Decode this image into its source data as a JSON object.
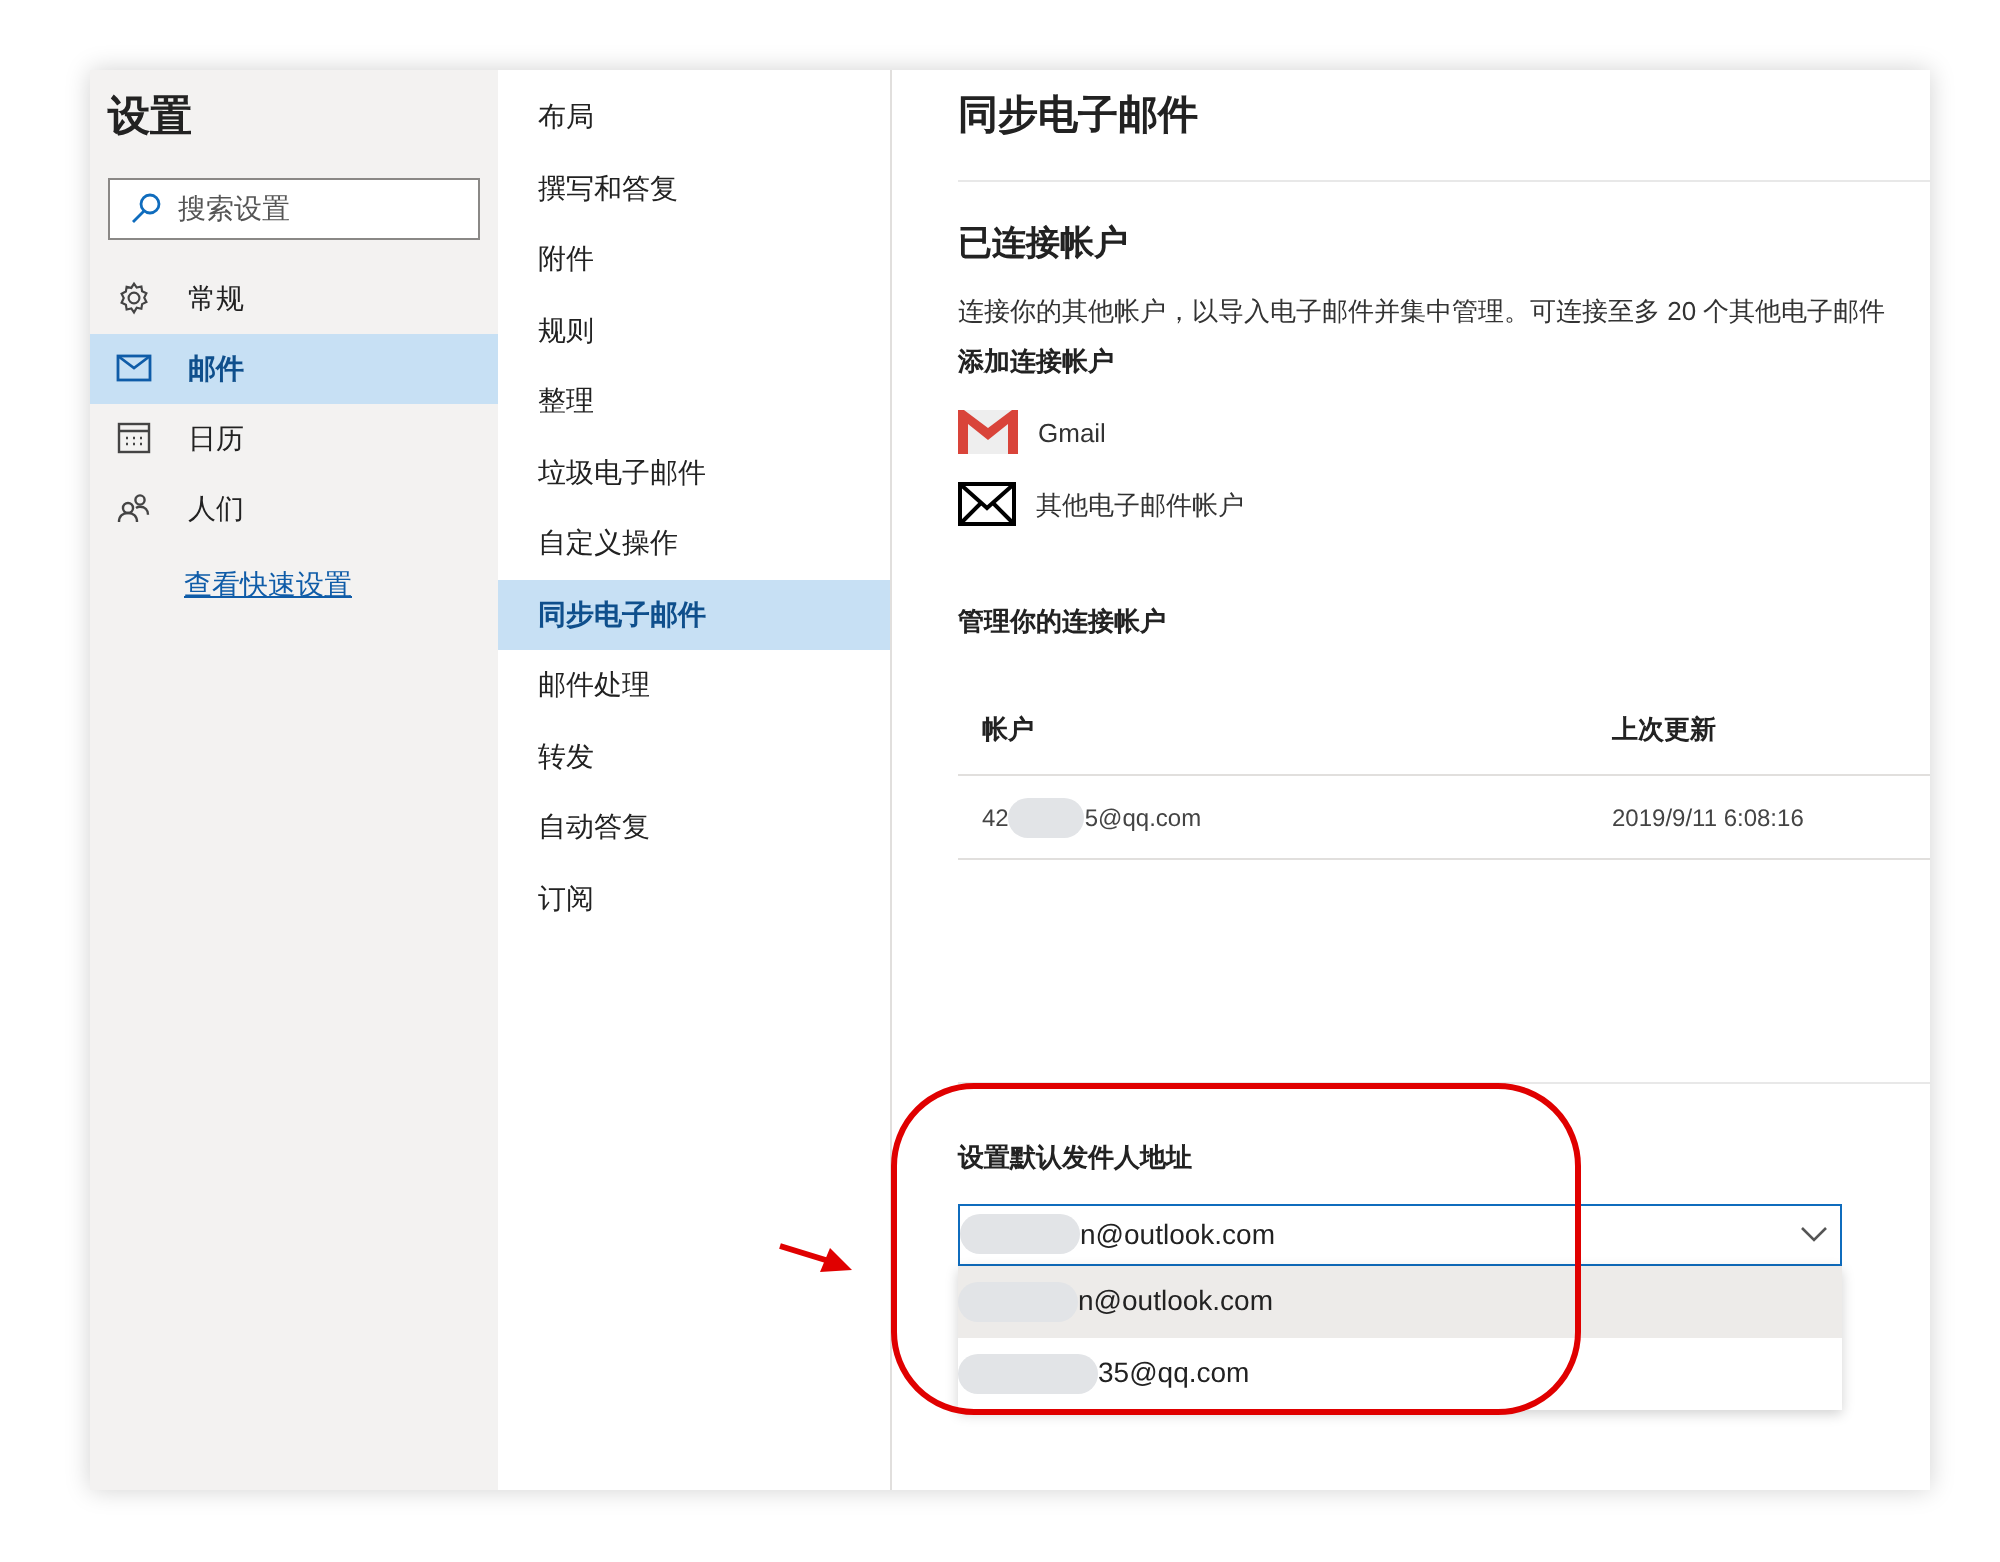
{
  "sidebar": {
    "title": "设置",
    "search": {
      "placeholder": "搜索设置"
    },
    "items": [
      {
        "kind": "gear",
        "label": "常规",
        "selected": false
      },
      {
        "kind": "mail",
        "label": "邮件",
        "selected": true
      },
      {
        "kind": "calendar",
        "label": "日历",
        "selected": false
      },
      {
        "kind": "people",
        "label": "人们",
        "selected": false
      }
    ],
    "link": "查看快速设置"
  },
  "subnav": {
    "items": [
      {
        "label": "布局",
        "selected": false
      },
      {
        "label": "撰写和答复",
        "selected": false
      },
      {
        "label": "附件",
        "selected": false
      },
      {
        "label": "规则",
        "selected": false
      },
      {
        "label": "整理",
        "selected": false
      },
      {
        "label": "垃圾电子邮件",
        "selected": false
      },
      {
        "label": "自定义操作",
        "selected": false
      },
      {
        "label": "同步电子邮件",
        "selected": true
      },
      {
        "label": "邮件处理",
        "selected": false
      },
      {
        "label": "转发",
        "selected": false
      },
      {
        "label": "自动答复",
        "selected": false
      },
      {
        "label": "订阅",
        "selected": false
      }
    ]
  },
  "content": {
    "title": "同步电子邮件",
    "section_title": "已连接帐户",
    "description": "连接你的其他帐户，以导入电子邮件并集中管理。可连接至多 20 个其他电子邮件",
    "add_title": "添加连接帐户",
    "providers": [
      {
        "kind": "gmail",
        "label": "Gmail"
      },
      {
        "kind": "envelope",
        "label": "其他电子邮件帐户"
      }
    ],
    "manage_title": "管理你的连接帐户",
    "table": {
      "columns": [
        "帐户",
        "上次更新"
      ],
      "rows": [
        {
          "account_start": "42",
          "account_end": "5@qq.com",
          "updated": "2019/9/11 6:08:16"
        }
      ]
    },
    "default_sender": {
      "title": "设置默认发件人地址",
      "value": "n@outlook.com",
      "expanded": true,
      "options": [
        {
          "label": "n@outlook.com",
          "selected": true
        },
        {
          "label": "35@qq.com",
          "selected": false
        }
      ]
    }
  }
}
